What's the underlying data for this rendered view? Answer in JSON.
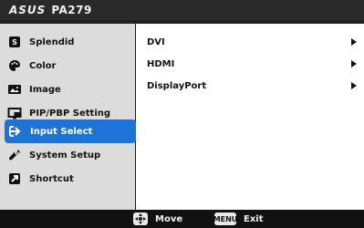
{
  "header": {
    "brand": "ASUS",
    "model": "PA279"
  },
  "sidebar": {
    "items": [
      {
        "label": "Splendid",
        "icon": "splendid-icon"
      },
      {
        "label": "Color",
        "icon": "palette-icon"
      },
      {
        "label": "Image",
        "icon": "image-icon"
      },
      {
        "label": "PIP/PBP Setting",
        "icon": "pip-pbp-icon"
      },
      {
        "label": "Input Select",
        "icon": "input-select-icon",
        "selected": true
      },
      {
        "label": "System Setup",
        "icon": "wrench-icon"
      },
      {
        "label": "Shortcut",
        "icon": "shortcut-icon"
      }
    ]
  },
  "content": {
    "items": [
      {
        "label": "DVI"
      },
      {
        "label": "HDMI"
      },
      {
        "label": "DisplayPort"
      }
    ]
  },
  "footer": {
    "move_label": "Move",
    "exit_label": "Exit",
    "menu_key_label": "MENU",
    "move_icon": "dpad-icon"
  },
  "colors": {
    "accent": "#1f72d6",
    "sidebar_bg": "#dcdcdc",
    "content_bg": "#ffffff",
    "dark_bar": "#111111"
  }
}
